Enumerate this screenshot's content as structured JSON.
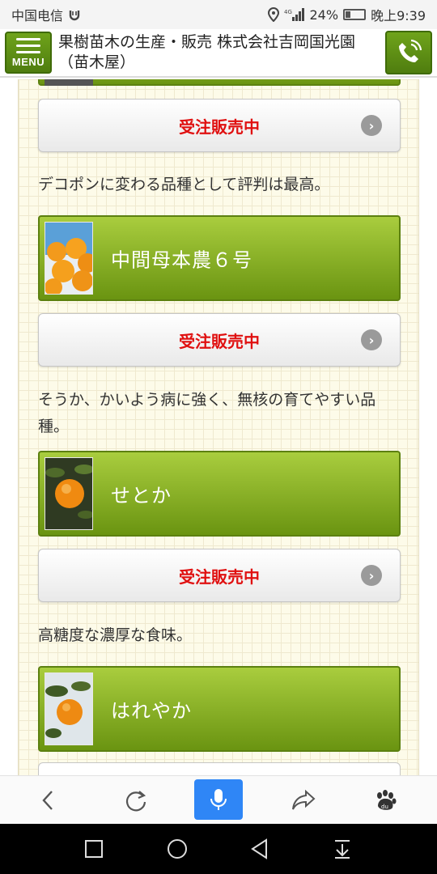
{
  "status_bar": {
    "carrier": "中国电信",
    "battery_pct": "24%",
    "battery_level": 0.24,
    "time": "晚上9:39"
  },
  "header": {
    "menu_label": "MENU",
    "title": "果樹苗木の生産・販売 株式会社吉岡国光園（苗木屋）"
  },
  "content": {
    "items": [
      {
        "order_label": "受注販売中",
        "desc": "デコポンに変わる品種として評判は最高。"
      },
      {
        "name": "中間母本農６号",
        "order_label": "受注販売中",
        "desc": "そうか、かいよう病に強く、無核の育てやすい品種。"
      },
      {
        "name": "せとか",
        "order_label": "受注販売中",
        "desc": "高糖度な濃厚な食味。"
      },
      {
        "name": "はれやか"
      }
    ]
  },
  "browser_bar": {
    "icons": [
      "back-icon",
      "refresh-icon",
      "microphone-icon",
      "share-icon",
      "paw-icon"
    ]
  },
  "nav_bar": {
    "icons": [
      "recent-apps-icon",
      "home-icon",
      "back-triangle-icon",
      "download-icon"
    ]
  },
  "colors": {
    "accent_green": "#6a9311",
    "order_red": "#e01010",
    "mic_blue": "#2f86f6"
  }
}
